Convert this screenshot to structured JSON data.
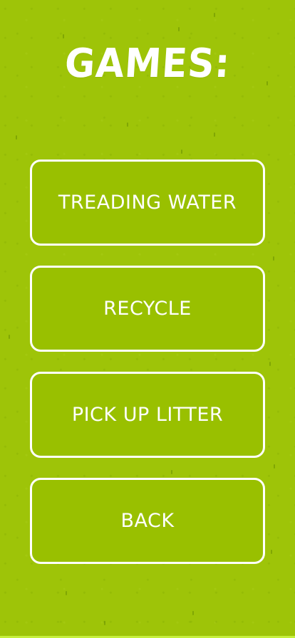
{
  "page": {
    "title": "GAMES:"
  },
  "menu": {
    "items": [
      {
        "label": "TREADING WATER"
      },
      {
        "label": "RECYCLE"
      },
      {
        "label": "PICK UP LITTER"
      },
      {
        "label": "BACK"
      }
    ]
  },
  "colors": {
    "background": "#9ec408",
    "button_fill": "#99c000",
    "button_border": "#ffffff",
    "text": "#ffffff"
  }
}
